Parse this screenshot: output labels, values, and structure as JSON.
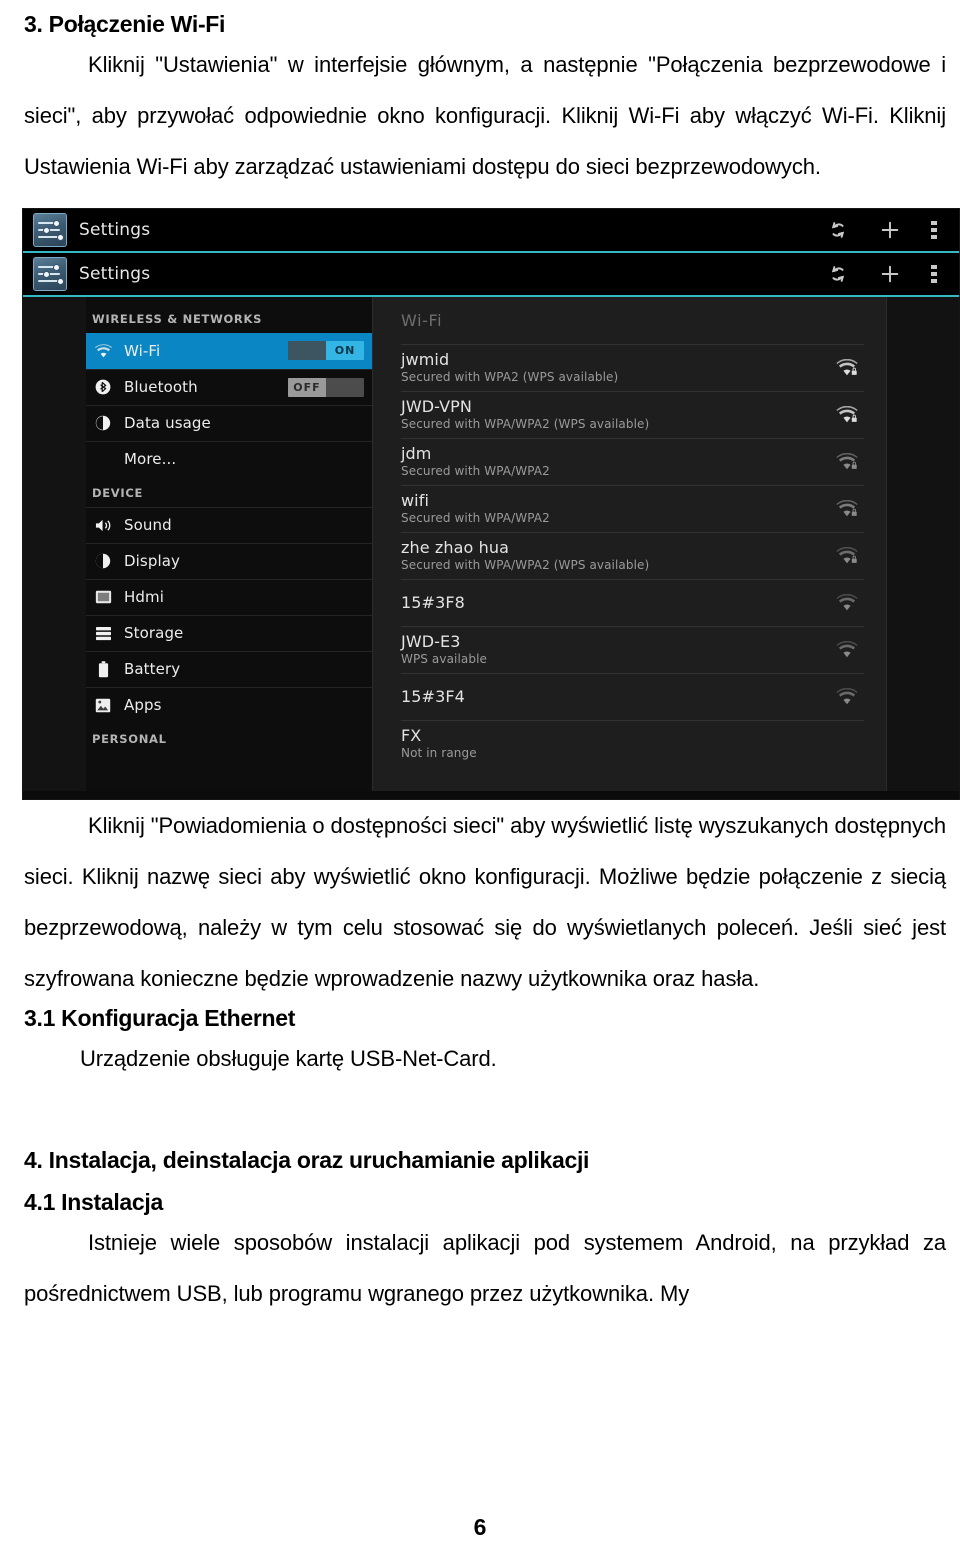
{
  "document": {
    "heading_3": "3. Połączenie Wi-Fi",
    "para_1": "Kliknij \"Ustawienia\" w interfejsie głównym, a następnie \"Połączenia bezprzewodowe i sieci\", aby przywołać odpowiednie okno konfiguracji. Kliknij Wi-Fi aby włączyć Wi-Fi. Kliknij Ustawienia Wi-Fi aby zarządzać ustawieniami dostępu do sieci bezprzewodowych.",
    "para_2": "Kliknij \"Powiadomienia o dostępności sieci\" aby wyświetlić listę wyszukanych dostępnych sieci. Kliknij nazwę sieci aby wyświetlić okno konfiguracji. Możliwe będzie połączenie z siecią bezprzewodową, należy w tym celu stosować się do wyświetlanych poleceń. Jeśli sieć jest szyfrowana konieczne będzie wprowadzenie nazwy użytkownika oraz hasła.",
    "heading_3_1": "3.1 Konfiguracja Ethernet",
    "para_3": "Urządzenie obsługuje kartę USB-Net-Card.",
    "heading_4": "4. Instalacja, deinstalacja oraz uruchamianie aplikacji",
    "heading_4_1": "4.1 Instalacja",
    "para_4": "Istnieje wiele sposobów instalacji aplikacji pod systemem Android, na przykład za pośrednictwem USB, lub programu wgranego przez użytkownika. My",
    "page_number": "6"
  },
  "screenshot": {
    "actionbar": {
      "title": "Settings",
      "app_icon": "settings-sliders-icon",
      "actions": [
        {
          "name": "wps-refresh-icon",
          "label": "WPS"
        },
        {
          "name": "add-network-icon",
          "label": "Add network"
        },
        {
          "name": "overflow-menu-icon",
          "label": "More options"
        }
      ]
    },
    "sidebar": {
      "sections": [
        {
          "label": "WIRELESS & NETWORKS",
          "items": [
            {
              "label": "Wi-Fi",
              "icon": "wifi-icon",
              "active": true,
              "toggle": "ON"
            },
            {
              "label": "Bluetooth",
              "icon": "bluetooth-icon",
              "active": false,
              "toggle": "OFF"
            },
            {
              "label": "Data usage",
              "icon": "data-usage-icon",
              "active": false,
              "toggle": null
            },
            {
              "label": "More...",
              "icon": null,
              "active": false,
              "toggle": null
            }
          ]
        },
        {
          "label": "DEVICE",
          "items": [
            {
              "label": "Sound",
              "icon": "sound-icon",
              "active": false,
              "toggle": null
            },
            {
              "label": "Display",
              "icon": "display-icon",
              "active": false,
              "toggle": null
            },
            {
              "label": "Hdmi",
              "icon": "hdmi-icon",
              "active": false,
              "toggle": null
            },
            {
              "label": "Storage",
              "icon": "storage-icon",
              "active": false,
              "toggle": null
            },
            {
              "label": "Battery",
              "icon": "battery-icon",
              "active": false,
              "toggle": null
            },
            {
              "label": "Apps",
              "icon": "apps-icon",
              "active": false,
              "toggle": null
            }
          ]
        },
        {
          "label": "PERSONAL",
          "items": []
        }
      ]
    },
    "content": {
      "title": "Wi-Fi",
      "networks": [
        {
          "ssid": "jwmid",
          "security": "Secured with WPA2 (WPS available)",
          "locked": true,
          "strength": 4
        },
        {
          "ssid": "JWD-VPN",
          "security": "Secured with WPA/WPA2 (WPS available)",
          "locked": true,
          "strength": 4
        },
        {
          "ssid": "jdm",
          "security": "Secured with WPA/WPA2",
          "locked": true,
          "strength": 3
        },
        {
          "ssid": "wifi",
          "security": "Secured with WPA/WPA2",
          "locked": true,
          "strength": 3
        },
        {
          "ssid": "zhe zhao hua",
          "security": "Secured with WPA/WPA2 (WPS available)",
          "locked": true,
          "strength": 2
        },
        {
          "ssid": "15#3F8",
          "security": "",
          "locked": false,
          "strength": 2
        },
        {
          "ssid": "JWD-E3",
          "security": "WPS available",
          "locked": false,
          "strength": 2
        },
        {
          "ssid": "15#3F4",
          "security": "",
          "locked": false,
          "strength": 2
        },
        {
          "ssid": "FX",
          "security": "Not in range",
          "locked": false,
          "strength": 0
        }
      ]
    },
    "colors": {
      "accent_blue": "#0a86c4",
      "toggle_on": "#33b5e5",
      "actionbar_underline": "#34b8c4",
      "content_bg": "#1e1e1e",
      "sidebar_bg": "#0d0d0d"
    }
  }
}
